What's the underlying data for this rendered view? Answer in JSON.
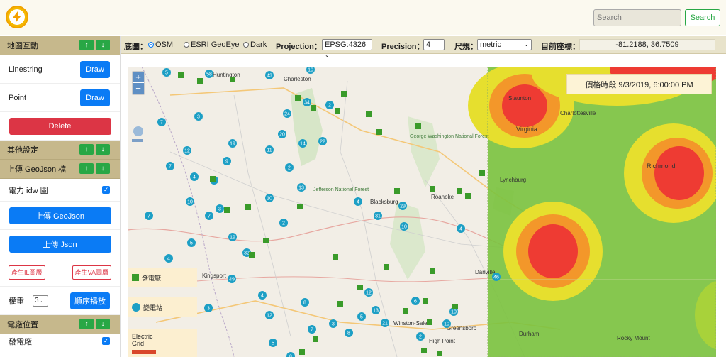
{
  "header": {
    "search_placeholder": "Search",
    "search_button": "Search"
  },
  "sidebar": {
    "map_interaction": "地圖互動",
    "linestring_label": "Linestring",
    "point_label": "Point",
    "draw_label": "Draw",
    "delete_label": "Delete",
    "other_settings": "其他設定",
    "upload_geojson_section": "上傳 GeoJson 檔",
    "power_idw_label": "電力 idw 圖",
    "upload_geojson_button": "上傳 GeoJson",
    "upload_json_button": "上傳 Json",
    "gen_il_button": "產生IL圖層",
    "gen_va_button": "產生VA圖層",
    "weight_label": "權重",
    "weight_value": "3",
    "sequential_play_button": "順序播放",
    "plant_location": "電廠位置",
    "power_plant_label": "發電廠"
  },
  "toolbar": {
    "basemap_label": "底圖：",
    "basemap_options": [
      "OSM",
      "ESRI GeoEye",
      "Dark"
    ],
    "basemap_selected": "OSM",
    "projection_label": "Projection：",
    "projection_value": "EPSG:4326",
    "precision_label": "Precision：",
    "precision_value": "4",
    "scale_label": "尺規：",
    "scale_value": "metric",
    "current_coord_label": "目前座標：",
    "current_coord_value": "-81.2188, 36.7509"
  },
  "map": {
    "time_label": "價格時段 9/3/2019, 6:00:00 PM",
    "legend_power_plant": "發電廠",
    "legend_substation": "變電站",
    "legend_grid": "Electric Grid",
    "place_names": [
      "Huntington",
      "Charleston",
      "Staunton",
      "Charlottesville",
      "Virginia",
      "Richmond",
      "Lynchburg",
      "Blacksburg",
      "Roanoke",
      "Danville",
      "Kingsport",
      "Winston-Salem",
      "Greensboro",
      "High Point",
      "Durham",
      "Rocky Mount",
      "Jefferson National Forest",
      "George Washington National Forest"
    ],
    "cluster_counts": [
      "5",
      "58",
      "43",
      "10",
      "34",
      "2",
      "3",
      "7",
      "24",
      "20",
      "14",
      "22",
      "12",
      "19",
      "11",
      "9",
      "5",
      "2",
      "13",
      "4",
      "29",
      "31",
      "10",
      "32",
      "49",
      "4",
      "46",
      "10",
      "13",
      "21",
      "5",
      "8",
      "2",
      "10",
      "6",
      "12",
      "4",
      "3",
      "9",
      "12",
      "8",
      "7",
      "3",
      "5",
      "8",
      "7",
      "19",
      "4",
      "5",
      "4",
      "10",
      "3",
      "7",
      "10",
      "2",
      "7"
    ],
    "accent_colors": {
      "cluster": "#1d9fc5",
      "plant": "#3a9b2a",
      "heat_high": "#ee3030",
      "heat_mid": "#f5a020",
      "heat_low": "#78c23a",
      "button_blue": "#0a7bf5",
      "button_green": "#28a745",
      "button_red": "#dc3545",
      "section": "#c6b88c"
    }
  }
}
